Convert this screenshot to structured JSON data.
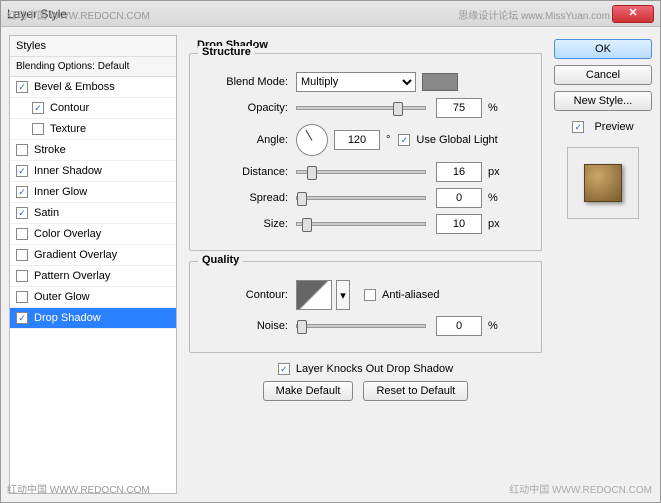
{
  "window": {
    "title": "Layer Style"
  },
  "watermarks": {
    "topLeft": "红动中国 WWW.REDOCN.COM",
    "topRight": "思缘设计论坛 www.MissYuan.com",
    "bottomLeft": "红动中国 WWW.REDOCN.COM",
    "bottomRight": "红动中国 WWW.REDOCN.COM"
  },
  "left": {
    "header": "Styles",
    "subheader": "Blending Options: Default",
    "items": [
      {
        "label": "Bevel & Emboss",
        "checked": true
      },
      {
        "label": "Contour",
        "checked": true,
        "sub": true
      },
      {
        "label": "Texture",
        "checked": false,
        "sub": true
      },
      {
        "label": "Stroke",
        "checked": false
      },
      {
        "label": "Inner Shadow",
        "checked": true
      },
      {
        "label": "Inner Glow",
        "checked": true
      },
      {
        "label": "Satin",
        "checked": true
      },
      {
        "label": "Color Overlay",
        "checked": false
      },
      {
        "label": "Gradient Overlay",
        "checked": false
      },
      {
        "label": "Pattern Overlay",
        "checked": false
      },
      {
        "label": "Outer Glow",
        "checked": false
      },
      {
        "label": "Drop Shadow",
        "checked": true,
        "selected": true
      }
    ]
  },
  "center": {
    "title": "Drop Shadow",
    "structure": {
      "legend": "Structure",
      "blendModeLabel": "Blend Mode:",
      "blendMode": "Multiply",
      "opacityLabel": "Opacity:",
      "opacity": "75",
      "opacityUnit": "%",
      "angleLabel": "Angle:",
      "angle": "120",
      "angleUnit": "°",
      "useGlobalLabel": "Use Global Light",
      "useGlobal": true,
      "distanceLabel": "Distance:",
      "distance": "16",
      "distanceUnit": "px",
      "spreadLabel": "Spread:",
      "spread": "0",
      "spreadUnit": "%",
      "sizeLabel": "Size:",
      "size": "10",
      "sizeUnit": "px"
    },
    "quality": {
      "legend": "Quality",
      "contourLabel": "Contour:",
      "antiAliasLabel": "Anti-aliased",
      "antiAliased": false,
      "noiseLabel": "Noise:",
      "noise": "0",
      "noiseUnit": "%"
    },
    "knockoutLabel": "Layer Knocks Out Drop Shadow",
    "knockout": true,
    "makeDefault": "Make Default",
    "resetDefault": "Reset to Default"
  },
  "right": {
    "ok": "OK",
    "cancel": "Cancel",
    "newStyle": "New Style...",
    "previewLabel": "Preview",
    "preview": true
  }
}
